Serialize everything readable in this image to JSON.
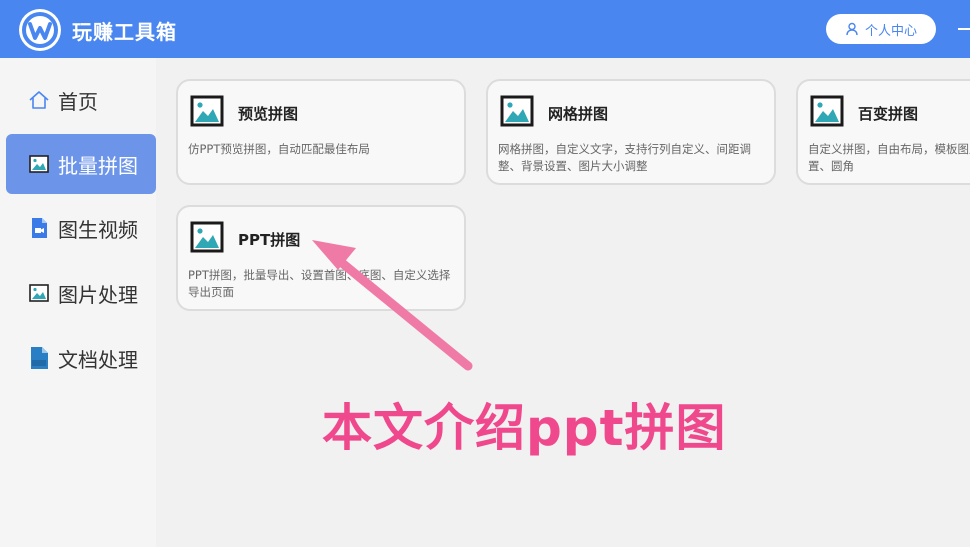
{
  "header": {
    "app_title": "玩赚工具箱",
    "profile_label": "个人中心"
  },
  "sidebar": {
    "items": [
      {
        "label": "首页",
        "icon": "home-icon",
        "active": false
      },
      {
        "label": "批量拼图",
        "icon": "image-collage-icon",
        "active": true
      },
      {
        "label": "图生视频",
        "icon": "video-file-icon",
        "active": false
      },
      {
        "label": "图片处理",
        "icon": "image-icon",
        "active": false
      },
      {
        "label": "文档处理",
        "icon": "doc-file-icon",
        "active": false
      }
    ]
  },
  "cards": [
    {
      "title": "预览拼图",
      "desc": "仿PPT预览拼图，自动匹配最佳布局",
      "icon": "picture-icon"
    },
    {
      "title": "网格拼图",
      "desc": "网格拼图，自定义文字，支持行列自定义、间距调整、背景设置、图片大小调整",
      "icon": "picture-icon"
    },
    {
      "title": "百变拼图",
      "desc": "自定义拼图，自由布局，模板图片大小调整、背景设置、圆角",
      "icon": "picture-icon"
    },
    {
      "title": "PPT拼图",
      "desc": "PPT拼图，批量导出、设置首图、底图、自定义选择导出页面",
      "icon": "picture-icon"
    }
  ],
  "annotation": {
    "text": "本文介绍ppt拼图",
    "color": "#f0488c"
  },
  "colors": {
    "header_bg": "#4a86f0",
    "sidebar_active": "#6c95ea",
    "icon_teal": "#2fa7b5"
  }
}
